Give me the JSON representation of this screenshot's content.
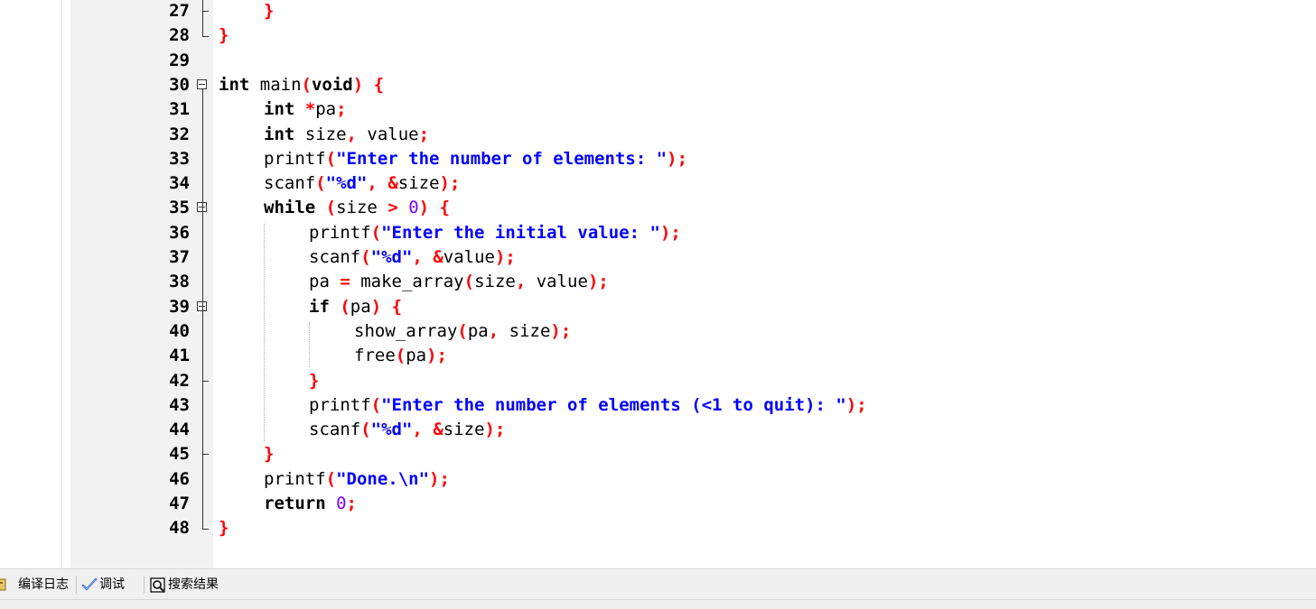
{
  "editor": {
    "lines": [
      {
        "n": "27",
        "fold": "tick",
        "indent": 1,
        "tokens": [
          [
            "sym",
            "}"
          ]
        ]
      },
      {
        "n": "28",
        "fold": "end",
        "indent": 0,
        "tokens": [
          [
            "sym",
            "}"
          ]
        ]
      },
      {
        "n": "29",
        "fold": "",
        "indent": 0,
        "tokens": []
      },
      {
        "n": "30",
        "fold": "box",
        "indent": 0,
        "tokens": [
          [
            "kw",
            "int"
          ],
          [
            "id",
            " main"
          ],
          [
            "sym",
            "("
          ],
          [
            "kw",
            "void"
          ],
          [
            "sym",
            ")"
          ],
          [
            "id",
            " "
          ],
          [
            "sym",
            "{"
          ]
        ]
      },
      {
        "n": "31",
        "fold": "",
        "indent": 1,
        "tokens": [
          [
            "kw",
            "int"
          ],
          [
            "id",
            " "
          ],
          [
            "sym",
            "*"
          ],
          [
            "id",
            "pa"
          ],
          [
            "sym",
            ";"
          ]
        ]
      },
      {
        "n": "32",
        "fold": "",
        "indent": 1,
        "tokens": [
          [
            "kw",
            "int"
          ],
          [
            "id",
            " size"
          ],
          [
            "sym",
            ","
          ],
          [
            "id",
            " value"
          ],
          [
            "sym",
            ";"
          ]
        ]
      },
      {
        "n": "33",
        "fold": "",
        "indent": 1,
        "tokens": [
          [
            "id",
            "printf"
          ],
          [
            "sym",
            "("
          ],
          [
            "str",
            "\"Enter the number of elements: \""
          ],
          [
            "sym",
            ");"
          ]
        ]
      },
      {
        "n": "34",
        "fold": "",
        "indent": 1,
        "tokens": [
          [
            "id",
            "scanf"
          ],
          [
            "sym",
            "("
          ],
          [
            "str",
            "\"%d\""
          ],
          [
            "sym",
            ","
          ],
          [
            "id",
            " "
          ],
          [
            "sym",
            "&"
          ],
          [
            "id",
            "size"
          ],
          [
            "sym",
            ");"
          ]
        ]
      },
      {
        "n": "35",
        "fold": "box",
        "indent": 1,
        "tokens": [
          [
            "kw",
            "while"
          ],
          [
            "id",
            " "
          ],
          [
            "sym",
            "("
          ],
          [
            "id",
            "size "
          ],
          [
            "sym",
            ">"
          ],
          [
            "id",
            " "
          ],
          [
            "num",
            "0"
          ],
          [
            "sym",
            ")"
          ],
          [
            "id",
            " "
          ],
          [
            "sym",
            "{"
          ]
        ]
      },
      {
        "n": "36",
        "fold": "",
        "indent": 2,
        "tokens": [
          [
            "id",
            "printf"
          ],
          [
            "sym",
            "("
          ],
          [
            "str",
            "\"Enter the initial value: \""
          ],
          [
            "sym",
            ");"
          ]
        ]
      },
      {
        "n": "37",
        "fold": "",
        "indent": 2,
        "tokens": [
          [
            "id",
            "scanf"
          ],
          [
            "sym",
            "("
          ],
          [
            "str",
            "\"%d\""
          ],
          [
            "sym",
            ","
          ],
          [
            "id",
            " "
          ],
          [
            "sym",
            "&"
          ],
          [
            "id",
            "value"
          ],
          [
            "sym",
            ");"
          ]
        ]
      },
      {
        "n": "38",
        "fold": "",
        "indent": 2,
        "tokens": [
          [
            "id",
            "pa "
          ],
          [
            "sym",
            "="
          ],
          [
            "id",
            " make_array"
          ],
          [
            "sym",
            "("
          ],
          [
            "id",
            "size"
          ],
          [
            "sym",
            ","
          ],
          [
            "id",
            " value"
          ],
          [
            "sym",
            ");"
          ]
        ]
      },
      {
        "n": "39",
        "fold": "box",
        "indent": 2,
        "tokens": [
          [
            "kw",
            "if"
          ],
          [
            "id",
            " "
          ],
          [
            "sym",
            "("
          ],
          [
            "id",
            "pa"
          ],
          [
            "sym",
            ")"
          ],
          [
            "id",
            " "
          ],
          [
            "sym",
            "{"
          ]
        ]
      },
      {
        "n": "40",
        "fold": "",
        "indent": 3,
        "tokens": [
          [
            "id",
            "show_array"
          ],
          [
            "sym",
            "("
          ],
          [
            "id",
            "pa"
          ],
          [
            "sym",
            ","
          ],
          [
            "id",
            " size"
          ],
          [
            "sym",
            ");"
          ]
        ]
      },
      {
        "n": "41",
        "fold": "",
        "indent": 3,
        "tokens": [
          [
            "id",
            "free"
          ],
          [
            "sym",
            "("
          ],
          [
            "id",
            "pa"
          ],
          [
            "sym",
            ");"
          ]
        ]
      },
      {
        "n": "42",
        "fold": "tick",
        "indent": 2,
        "tokens": [
          [
            "sym",
            "}"
          ]
        ]
      },
      {
        "n": "43",
        "fold": "",
        "indent": 2,
        "tokens": [
          [
            "id",
            "printf"
          ],
          [
            "sym",
            "("
          ],
          [
            "str",
            "\"Enter the number of elements (<1 to quit): \""
          ],
          [
            "sym",
            ");"
          ]
        ]
      },
      {
        "n": "44",
        "fold": "",
        "indent": 2,
        "tokens": [
          [
            "id",
            "scanf"
          ],
          [
            "sym",
            "("
          ],
          [
            "str",
            "\"%d\""
          ],
          [
            "sym",
            ","
          ],
          [
            "id",
            " "
          ],
          [
            "sym",
            "&"
          ],
          [
            "id",
            "size"
          ],
          [
            "sym",
            ");"
          ]
        ]
      },
      {
        "n": "45",
        "fold": "tick",
        "indent": 1,
        "tokens": [
          [
            "sym",
            "}"
          ]
        ]
      },
      {
        "n": "46",
        "fold": "",
        "indent": 1,
        "tokens": [
          [
            "id",
            "printf"
          ],
          [
            "sym",
            "("
          ],
          [
            "str",
            "\"Done.\\n\""
          ],
          [
            "sym",
            ");"
          ]
        ]
      },
      {
        "n": "47",
        "fold": "",
        "indent": 1,
        "tokens": [
          [
            "kw",
            "return"
          ],
          [
            "id",
            " "
          ],
          [
            "num",
            "0"
          ],
          [
            "sym",
            ";"
          ]
        ]
      },
      {
        "n": "48",
        "fold": "end",
        "indent": 0,
        "tokens": [
          [
            "sym",
            "}"
          ]
        ]
      }
    ]
  },
  "bottom_tabs": [
    {
      "label": "编译日志",
      "icon": "compile-log-icon"
    },
    {
      "label": "调试",
      "icon": "check-icon"
    },
    {
      "label": "搜索结果",
      "icon": "search-results-icon"
    }
  ],
  "colors": {
    "keyword": "#000000",
    "symbol": "#ff0000",
    "string": "#0000ff",
    "number": "#8000ff",
    "gutter": "#f2f2f2"
  }
}
